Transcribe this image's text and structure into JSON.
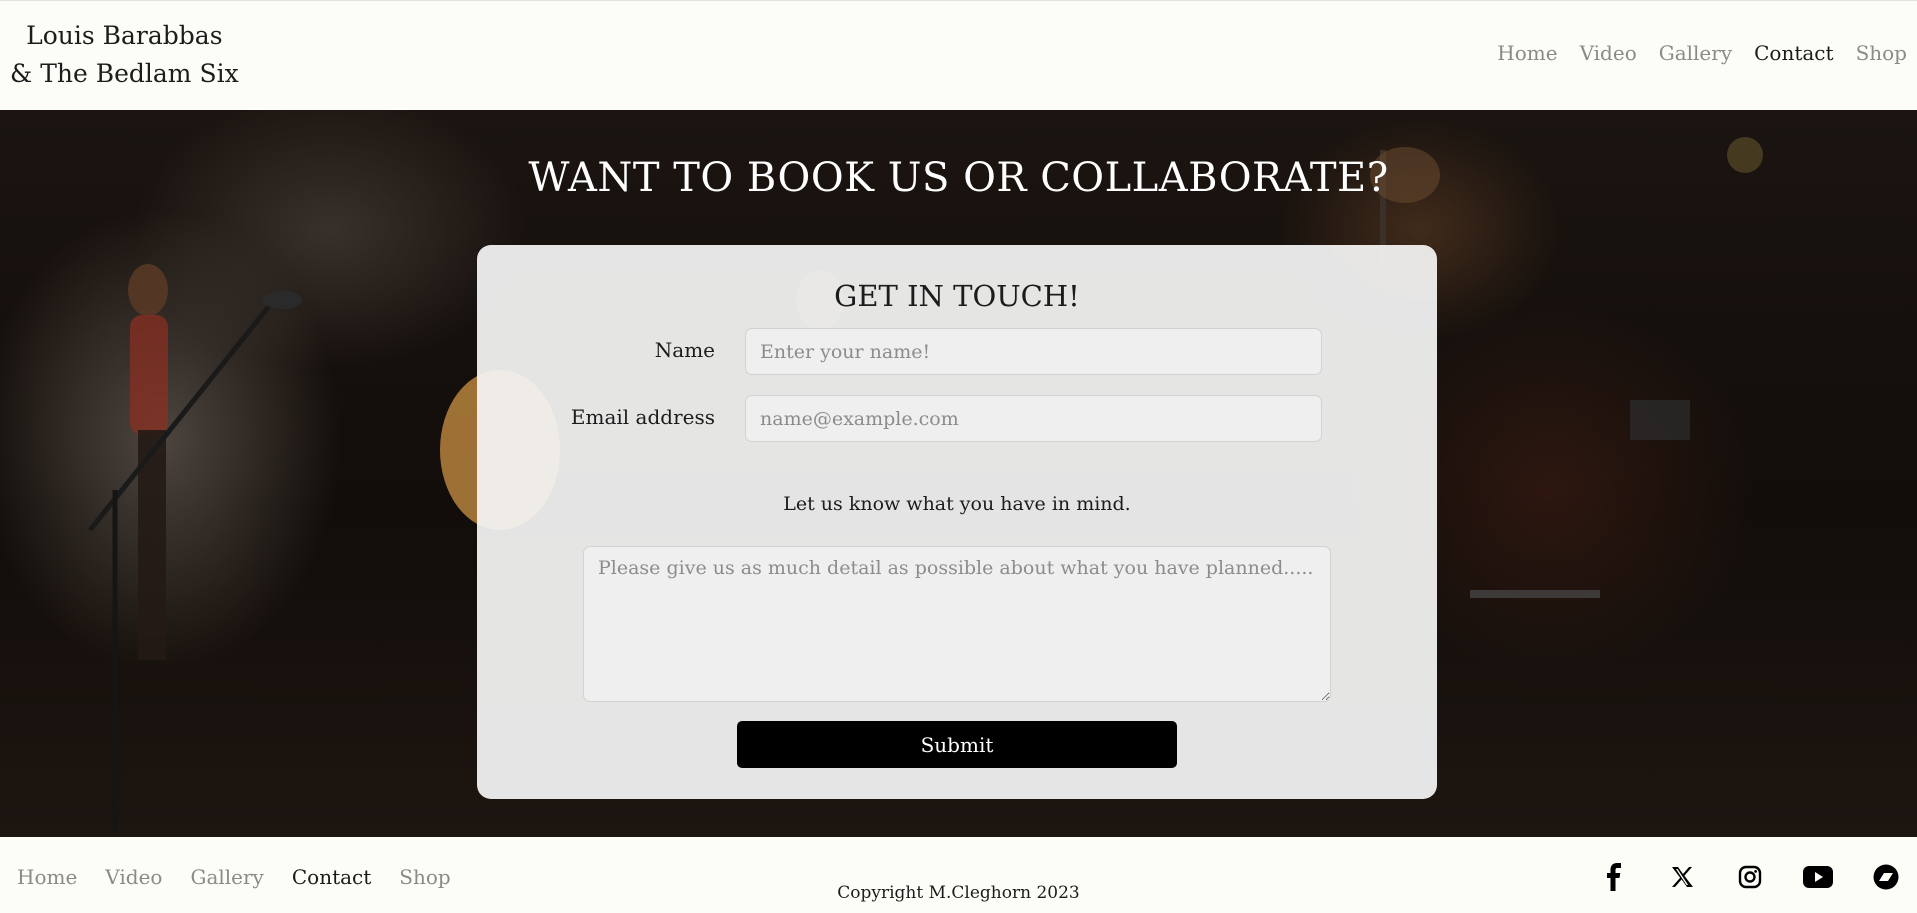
{
  "header": {
    "brand_line1": "Louis Barabbas",
    "brand_line2": "& The Bedlam Six",
    "nav": [
      "Home",
      "Video",
      "Gallery",
      "Contact",
      "Shop"
    ],
    "active_nav": "Contact"
  },
  "hero": {
    "title": "WANT TO BOOK US OR COLLABORATE?"
  },
  "form": {
    "title": "GET IN TOUCH!",
    "name_label": "Name",
    "name_placeholder": "Enter your name!",
    "email_label": "Email address",
    "email_placeholder": "name@example.com",
    "message_hint": "Let us know what you have in mind.",
    "message_placeholder": "Please give us as much detail as possible about what you have planned.....",
    "submit_label": "Submit"
  },
  "footer": {
    "nav": [
      "Home",
      "Video",
      "Gallery",
      "Contact",
      "Shop"
    ],
    "copyright": "Copyright M.Cleghorn 2023",
    "social_icons": [
      "facebook-icon",
      "x-icon",
      "instagram-icon",
      "youtube-icon",
      "bandcamp-icon"
    ]
  },
  "colors": {
    "background": "#fdfdf7",
    "nav_inactive": "#8a8a8a",
    "nav_active": "#1a1a1a",
    "button": "#000000",
    "card": "#f5f5f5"
  }
}
